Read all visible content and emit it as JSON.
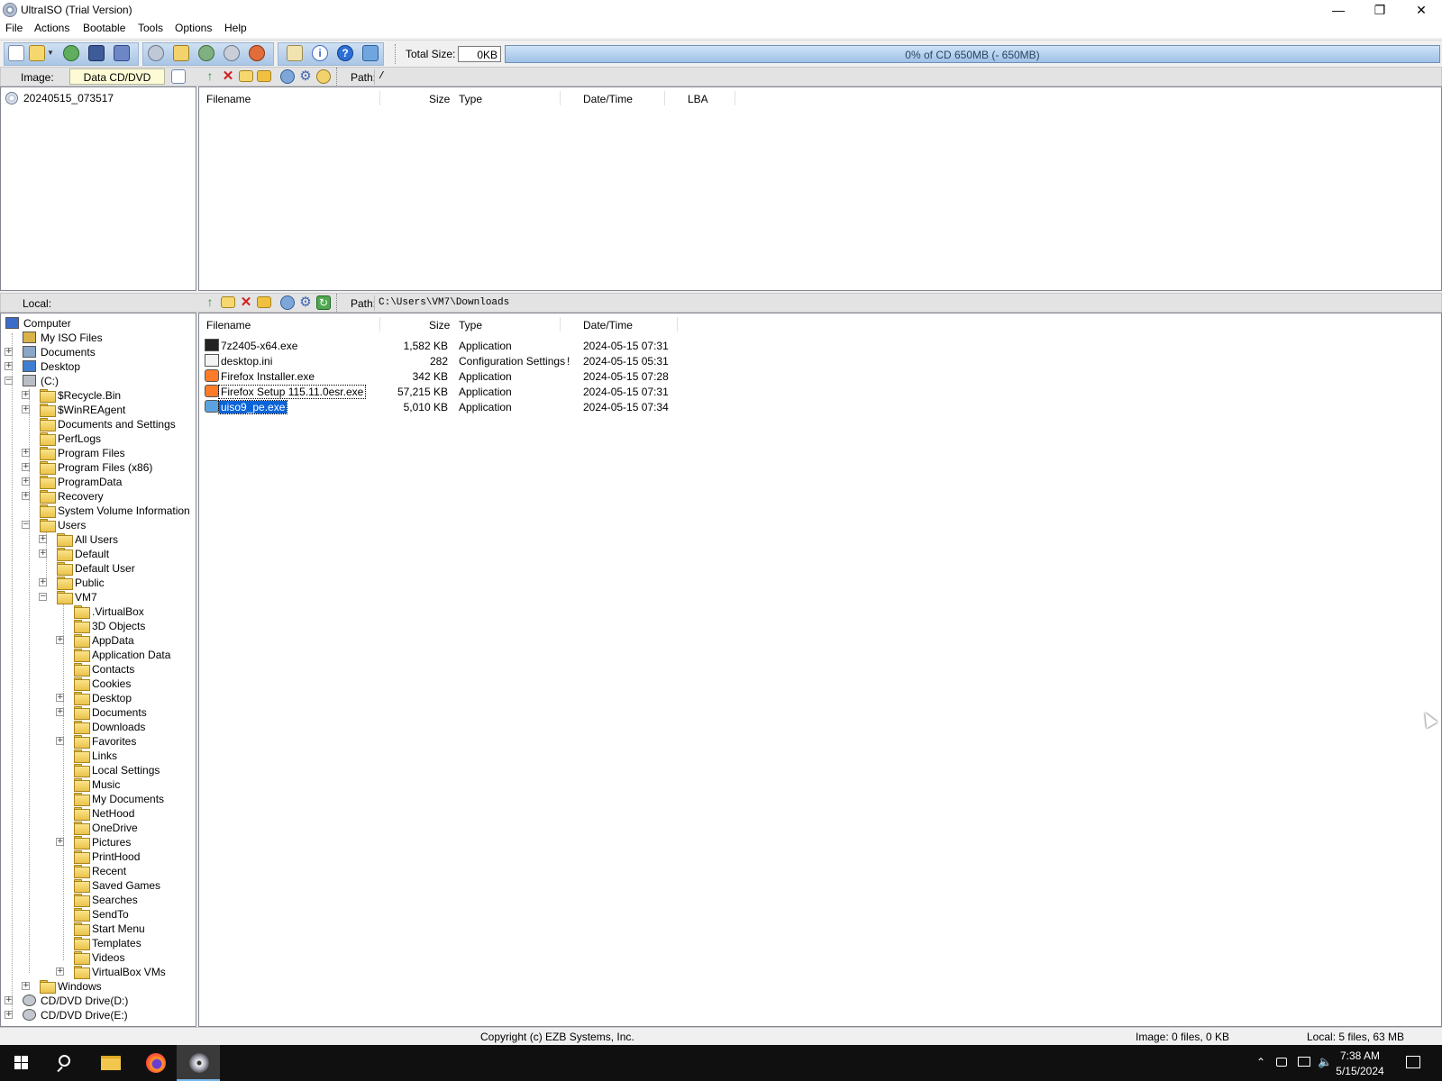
{
  "window": {
    "title": "UltraISO (Trial Version)",
    "minimize_glyph": "—",
    "maximize_glyph": "❐",
    "close_glyph": "✕"
  },
  "menu": [
    "File",
    "Actions",
    "Bootable",
    "Tools",
    "Options",
    "Help"
  ],
  "toolbar": {
    "icons": [
      "new-icon",
      "open-icon",
      "open-dropdown-icon",
      "reopen-icon",
      "save-icon",
      "save-as-icon",
      "extract-icon",
      "add-files-icon",
      "mount-icon",
      "make-cd-image-icon",
      "burn-icon",
      "properties-icon",
      "info-icon",
      "help-icon",
      "exit-icon"
    ],
    "total_size_label": "Total Size:",
    "total_size_value": "0KB",
    "capacity_text": "0% of CD 650MB (- 650MB)",
    "capacity_used_fraction": 0
  },
  "image_panel": {
    "label": "Image:",
    "type_value": "Data CD/DVD",
    "path_label": "Path:",
    "path_value": "/",
    "tree_root": "20240515_073517",
    "columns": [
      "Filename",
      "Size",
      "Type",
      "Date/Time",
      "LBA"
    ]
  },
  "local_panel": {
    "label": "Local:",
    "path_label": "Path:",
    "path_value": "C:\\Users\\VM7\\Downloads",
    "columns": [
      "Filename",
      "Size",
      "Type",
      "Date/Time"
    ],
    "files": [
      {
        "name": "7z2405-x64.exe",
        "size": "1,582 KB",
        "type": "Application",
        "date": "2024-05-15 07:31",
        "icon": "7zip-icon",
        "flag": ""
      },
      {
        "name": "desktop.ini",
        "size": "282",
        "type": "Configuration Settings",
        "date": "2024-05-15 05:31",
        "icon": "ini-file-icon",
        "flag": "!"
      },
      {
        "name": "Firefox Installer.exe",
        "size": "342 KB",
        "type": "Application",
        "date": "2024-05-15 07:28",
        "icon": "firefox-icon",
        "flag": ""
      },
      {
        "name": "Firefox Setup 115.11.0esr.exe",
        "size": "57,215 KB",
        "type": "Application",
        "date": "2024-05-15 07:31",
        "icon": "firefox-icon",
        "flag": ""
      },
      {
        "name": "uiso9_pe.exe",
        "size": "5,010 KB",
        "type": "Application",
        "date": "2024-05-15 07:34",
        "icon": "ultraiso-icon",
        "flag": ""
      }
    ],
    "selected_index": 4,
    "focus_index": 3
  },
  "tree": [
    {
      "label": "Computer",
      "level": 0,
      "exp": "",
      "icon": "computer-icon"
    },
    {
      "label": "My ISO Files",
      "level": 1,
      "exp": "",
      "icon": "iso-folder-icon"
    },
    {
      "label": "Documents",
      "level": 1,
      "exp": "+",
      "icon": "documents-icon"
    },
    {
      "label": "Desktop",
      "level": 1,
      "exp": "+",
      "icon": "desktop-icon"
    },
    {
      "label": "(C:)",
      "level": 1,
      "exp": "-",
      "icon": "drive-icon"
    },
    {
      "label": "$Recycle.Bin",
      "level": 2,
      "exp": "+",
      "icon": "folder-icon"
    },
    {
      "label": "$WinREAgent",
      "level": 2,
      "exp": "+",
      "icon": "folder-icon"
    },
    {
      "label": "Documents and Settings",
      "level": 2,
      "exp": "",
      "icon": "folder-icon"
    },
    {
      "label": "PerfLogs",
      "level": 2,
      "exp": "",
      "icon": "folder-icon"
    },
    {
      "label": "Program Files",
      "level": 2,
      "exp": "+",
      "icon": "folder-icon"
    },
    {
      "label": "Program Files (x86)",
      "level": 2,
      "exp": "+",
      "icon": "folder-icon"
    },
    {
      "label": "ProgramData",
      "level": 2,
      "exp": "+",
      "icon": "folder-icon"
    },
    {
      "label": "Recovery",
      "level": 2,
      "exp": "+",
      "icon": "folder-icon"
    },
    {
      "label": "System Volume Information",
      "level": 2,
      "exp": "",
      "icon": "folder-icon"
    },
    {
      "label": "Users",
      "level": 2,
      "exp": "-",
      "icon": "folder-icon"
    },
    {
      "label": "All Users",
      "level": 3,
      "exp": "+",
      "icon": "folder-icon"
    },
    {
      "label": "Default",
      "level": 3,
      "exp": "+",
      "icon": "folder-icon"
    },
    {
      "label": "Default User",
      "level": 3,
      "exp": "",
      "icon": "folder-icon"
    },
    {
      "label": "Public",
      "level": 3,
      "exp": "+",
      "icon": "folder-icon"
    },
    {
      "label": "VM7",
      "level": 3,
      "exp": "-",
      "icon": "folder-icon"
    },
    {
      "label": ".VirtualBox",
      "level": 4,
      "exp": "",
      "icon": "folder-icon"
    },
    {
      "label": "3D Objects",
      "level": 4,
      "exp": "",
      "icon": "folder-icon"
    },
    {
      "label": "AppData",
      "level": 4,
      "exp": "+",
      "icon": "folder-icon"
    },
    {
      "label": "Application Data",
      "level": 4,
      "exp": "",
      "icon": "folder-icon"
    },
    {
      "label": "Contacts",
      "level": 4,
      "exp": "",
      "icon": "folder-icon"
    },
    {
      "label": "Cookies",
      "level": 4,
      "exp": "",
      "icon": "folder-icon"
    },
    {
      "label": "Desktop",
      "level": 4,
      "exp": "+",
      "icon": "folder-icon"
    },
    {
      "label": "Documents",
      "level": 4,
      "exp": "+",
      "icon": "folder-icon"
    },
    {
      "label": "Downloads",
      "level": 4,
      "exp": "",
      "icon": "folder-icon"
    },
    {
      "label": "Favorites",
      "level": 4,
      "exp": "+",
      "icon": "folder-icon"
    },
    {
      "label": "Links",
      "level": 4,
      "exp": "",
      "icon": "folder-icon"
    },
    {
      "label": "Local Settings",
      "level": 4,
      "exp": "",
      "icon": "folder-icon"
    },
    {
      "label": "Music",
      "level": 4,
      "exp": "",
      "icon": "folder-icon"
    },
    {
      "label": "My Documents",
      "level": 4,
      "exp": "",
      "icon": "folder-icon"
    },
    {
      "label": "NetHood",
      "level": 4,
      "exp": "",
      "icon": "folder-icon"
    },
    {
      "label": "OneDrive",
      "level": 4,
      "exp": "",
      "icon": "folder-icon"
    },
    {
      "label": "Pictures",
      "level": 4,
      "exp": "+",
      "icon": "folder-icon"
    },
    {
      "label": "PrintHood",
      "level": 4,
      "exp": "",
      "icon": "folder-icon"
    },
    {
      "label": "Recent",
      "level": 4,
      "exp": "",
      "icon": "folder-icon"
    },
    {
      "label": "Saved Games",
      "level": 4,
      "exp": "",
      "icon": "folder-icon"
    },
    {
      "label": "Searches",
      "level": 4,
      "exp": "",
      "icon": "folder-icon"
    },
    {
      "label": "SendTo",
      "level": 4,
      "exp": "",
      "icon": "folder-icon"
    },
    {
      "label": "Start Menu",
      "level": 4,
      "exp": "",
      "icon": "folder-icon"
    },
    {
      "label": "Templates",
      "level": 4,
      "exp": "",
      "icon": "folder-icon"
    },
    {
      "label": "Videos",
      "level": 4,
      "exp": "",
      "icon": "folder-icon"
    },
    {
      "label": "VirtualBox VMs",
      "level": 4,
      "exp": "+",
      "icon": "folder-icon"
    },
    {
      "label": "Windows",
      "level": 2,
      "exp": "+",
      "icon": "folder-icon"
    },
    {
      "label": "CD/DVD Drive(D:)",
      "level": 1,
      "exp": "+",
      "icon": "cd-drive-icon"
    },
    {
      "label": "CD/DVD Drive(E:)",
      "level": 1,
      "exp": "+",
      "icon": "cd-drive-icon"
    }
  ],
  "status": {
    "copyright": "Copyright (c) EZB Systems, Inc.",
    "image_info": "Image: 0 files, 0 KB",
    "local_info": "Local: 5 files, 63 MB"
  },
  "taskbar": {
    "buttons": [
      "windows-start-icon",
      "search-icon",
      "file-explorer-icon",
      "firefox-icon",
      "ultraiso-icon"
    ],
    "tray_icons": [
      "chevron-up-icon",
      "meet-now-icon",
      "network-icon",
      "volume-muted-icon",
      "notification-icon"
    ],
    "time": "7:38 AM",
    "date": "5/15/2024"
  },
  "colors": {
    "selection": "#0a64d8",
    "taskbar": "#101010",
    "capacity_bar": "#9fc1e6"
  }
}
